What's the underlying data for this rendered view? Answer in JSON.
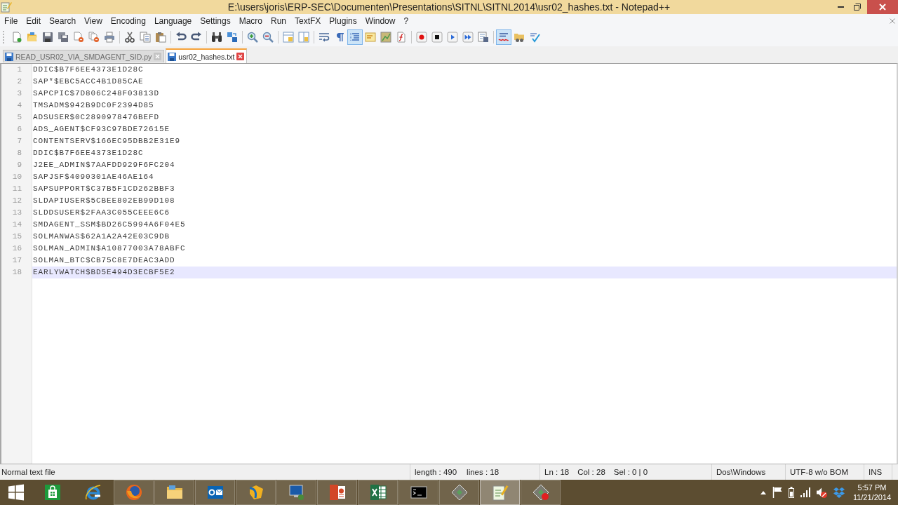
{
  "window": {
    "title": "E:\\users\\joris\\ERP-SEC\\Documenten\\Presentations\\SITNL\\SITNL2014\\usr02_hashes.txt - Notepad++"
  },
  "menu": [
    "File",
    "Edit",
    "Search",
    "View",
    "Encoding",
    "Language",
    "Settings",
    "Macro",
    "Run",
    "TextFX",
    "Plugins",
    "Window",
    "?"
  ],
  "toolbar": [
    {
      "buttons": [
        {
          "pressed": false
        },
        {
          "pressed": false
        },
        {
          "pressed": false
        },
        {
          "pressed": false
        },
        {
          "pressed": false
        },
        {
          "pressed": false
        },
        {
          "pressed": false
        }
      ]
    },
    {
      "buttons": [
        {
          "pressed": false
        },
        {
          "pressed": false
        },
        {
          "pressed": false
        }
      ]
    },
    {
      "buttons": [
        {
          "pressed": false
        },
        {
          "pressed": false
        }
      ]
    },
    {
      "buttons": [
        {
          "pressed": false
        },
        {
          "pressed": false
        }
      ]
    },
    {
      "buttons": [
        {
          "pressed": false
        },
        {
          "pressed": false
        }
      ]
    },
    {
      "buttons": [
        {
          "pressed": false
        },
        {
          "pressed": false
        }
      ]
    },
    {
      "buttons": [
        {
          "pressed": false
        },
        {
          "pressed": false
        },
        {
          "pressed": true
        },
        {
          "pressed": false
        },
        {
          "pressed": false
        },
        {
          "pressed": false
        }
      ]
    },
    {
      "buttons": [
        {
          "pressed": false
        },
        {
          "pressed": false
        },
        {
          "pressed": false
        },
        {
          "pressed": false
        },
        {
          "pressed": false
        }
      ]
    },
    {
      "buttons": [
        {
          "pressed": true
        },
        {
          "pressed": false
        },
        {
          "pressed": false
        }
      ]
    }
  ],
  "tabs": [
    {
      "label": "READ_USR02_VIA_SMDAGENT_SID.py",
      "selected": false
    },
    {
      "label": "usr02_hashes.txt",
      "selected": true
    }
  ],
  "editor": {
    "lines": [
      {
        "number": "1",
        "text": "DDIC$B7F6EE4373E1D28C",
        "current": false
      },
      {
        "number": "2",
        "text": "SAP*$EBC5ACC4B1D85CAE",
        "current": false
      },
      {
        "number": "3",
        "text": "SAPCPIC$7D806C248F03813D",
        "current": false
      },
      {
        "number": "4",
        "text": "TMSADM$942B9DC0F2394D85",
        "current": false
      },
      {
        "number": "5",
        "text": "ADSUSER$0C2890978476BEFD",
        "current": false
      },
      {
        "number": "6",
        "text": "ADS_AGENT$CF93C97BDE72615E",
        "current": false
      },
      {
        "number": "7",
        "text": "CONTENTSERV$166EC95DBB2E31E9",
        "current": false
      },
      {
        "number": "8",
        "text": "DDIC$B7F6EE4373E1D28C",
        "current": false
      },
      {
        "number": "9",
        "text": "J2EE_ADMIN$7AAFDD929F6FC204",
        "current": false
      },
      {
        "number": "10",
        "text": "SAPJSF$4090301AE46AE164",
        "current": false
      },
      {
        "number": "11",
        "text": "SAPSUPPORT$C37B5F1CD262BBF3",
        "current": false
      },
      {
        "number": "12",
        "text": "SLDAPIUSER$5CBEE802EB99D108",
        "current": false
      },
      {
        "number": "13",
        "text": "SLDDSUSER$2FAA3C055CEEE6C6",
        "current": false
      },
      {
        "number": "14",
        "text": "SMDAGENT_SSM$BD26C5994A6F04E5",
        "current": false
      },
      {
        "number": "15",
        "text": "SOLMANWAS$62A1A2A42E03C9DB",
        "current": false
      },
      {
        "number": "16",
        "text": "SOLMAN_ADMIN$A10877003A78ABFC",
        "current": false
      },
      {
        "number": "17",
        "text": "SOLMAN_BTC$CB75C8E7DEAC3ADD",
        "current": false
      },
      {
        "number": "18",
        "text": "EARLYWATCH$BD5E494D3ECBF5E2",
        "current": true
      }
    ]
  },
  "status_bar": {
    "file_type": "Normal text file",
    "length": "length : 490",
    "lines": "lines : 18",
    "line": "Ln : 18",
    "column": "Col : 28",
    "selection": "Sel : 0 | 0",
    "eol": "Dos\\Windows",
    "encoding": "UTF-8 w/o BOM",
    "mode": "INS"
  },
  "taskbar": {
    "apps": [
      {
        "running": false,
        "selected": false
      },
      {
        "running": false,
        "selected": false
      },
      {
        "running": true,
        "selected": false
      },
      {
        "running": true,
        "selected": false
      },
      {
        "running": true,
        "selected": false
      },
      {
        "running": true,
        "selected": false
      },
      {
        "running": true,
        "selected": false
      },
      {
        "running": true,
        "selected": false
      },
      {
        "running": true,
        "selected": false
      },
      {
        "running": true,
        "selected": false
      },
      {
        "running": true,
        "selected": false
      },
      {
        "running": true,
        "selected": true
      },
      {
        "running": true,
        "selected": false
      }
    ],
    "clock": {
      "time": "5:57 PM",
      "date": "11/21/2014"
    }
  }
}
